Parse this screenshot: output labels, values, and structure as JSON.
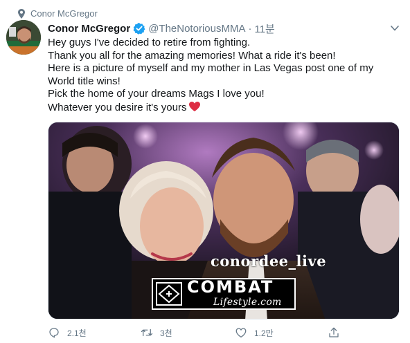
{
  "pinned": {
    "label": "Conor McGregor",
    "icon": "pin-icon"
  },
  "author": {
    "name": "Conor McGregor",
    "handle": "@TheNotoriousMMA",
    "separator": "·",
    "time": "11분",
    "verified": true
  },
  "tweet": {
    "lines": [
      "Hey guys I've decided to retire from fighting.",
      "Thank you all for the amazing memories! What a ride it's been!",
      "Here is a picture of myself and my mother in Las Vegas post one of my",
      "World title wins!",
      "Pick the home of your dreams Mags I love you!",
      "Whatever you desire it's yours"
    ],
    "emoji": "red-heart"
  },
  "media": {
    "watermark_handle": "conordee_live",
    "logo_main": "COMBAT",
    "logo_sub": "Lifestyle.com"
  },
  "actions": {
    "reply": {
      "icon": "reply-icon",
      "count": "2.1천"
    },
    "retweet": {
      "icon": "retweet-icon",
      "count": "3천"
    },
    "like": {
      "icon": "heart-icon",
      "count": "1.2만"
    },
    "share": {
      "icon": "share-icon"
    }
  },
  "colors": {
    "text": "#14171a",
    "secondary": "#657786",
    "verified": "#1da1f2",
    "heart": "#e0245e"
  }
}
